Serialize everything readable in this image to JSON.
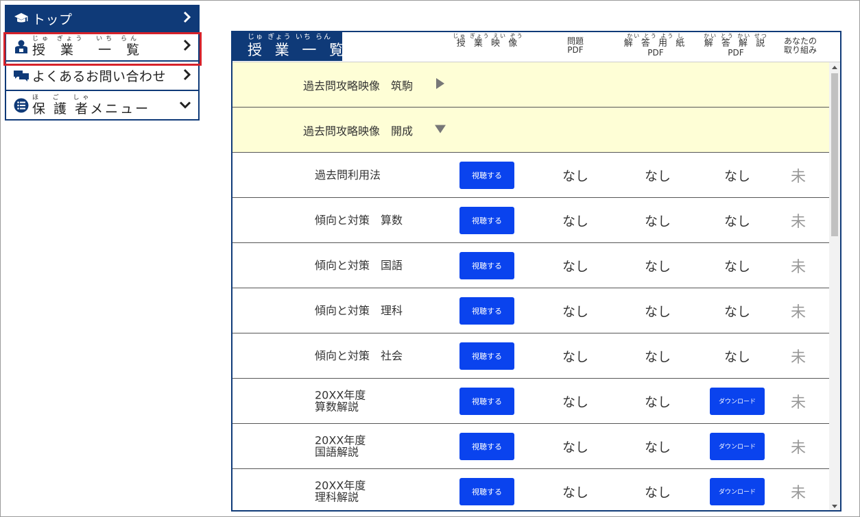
{
  "menu": {
    "top": {
      "label": "トップ"
    },
    "lessons": {
      "ruby": "じゅ ぎょう  いち らん",
      "label": "授 業  一 覧"
    },
    "faq": {
      "label": "よくあるお問い合わせ"
    },
    "guardian": {
      "ruby": "ほ  ご  しゃ",
      "label": "保 護 者メニュー"
    }
  },
  "panel": {
    "title_ruby": "じゅ ぎょう いち らん",
    "title": "授 業 一 覧",
    "columns": {
      "video": {
        "ruby": "じゅ ぎょう えい ぞう",
        "label": "授 業 映 像"
      },
      "problem": {
        "label": "問題",
        "sub": "PDF"
      },
      "answer_sheet": {
        "ruby": "かい とう よう し",
        "label": "解 答 用 紙",
        "sub": "PDF"
      },
      "explanation": {
        "ruby": "かい とう かい せつ",
        "label": "解 答 解 説",
        "sub": "PDF"
      },
      "effort": {
        "label": "あなたの",
        "label2": "取り組み"
      }
    }
  },
  "categories": [
    {
      "label": "過去問攻略映像　筑駒",
      "state": "collapsed"
    },
    {
      "label": "過去問攻略映像　開成",
      "state": "expanded"
    }
  ],
  "rows": [
    {
      "title": "過去問利用法",
      "watch": "視聴する",
      "problem": "なし",
      "answer_sheet": "なし",
      "explanation": "なし",
      "status": "未"
    },
    {
      "title": "傾向と対策　算数",
      "watch": "視聴する",
      "problem": "なし",
      "answer_sheet": "なし",
      "explanation": "なし",
      "status": "未"
    },
    {
      "title": "傾向と対策　国語",
      "watch": "視聴する",
      "problem": "なし",
      "answer_sheet": "なし",
      "explanation": "なし",
      "status": "未"
    },
    {
      "title": "傾向と対策　理科",
      "watch": "視聴する",
      "problem": "なし",
      "answer_sheet": "なし",
      "explanation": "なし",
      "status": "未"
    },
    {
      "title": "傾向と対策　社会",
      "watch": "視聴する",
      "problem": "なし",
      "answer_sheet": "なし",
      "explanation": "なし",
      "status": "未"
    },
    {
      "title": "20XX年度\n算数解説",
      "watch": "視聴する",
      "problem": "なし",
      "answer_sheet": "なし",
      "explanation": "ダウンロード",
      "status": "未"
    },
    {
      "title": "20XX年度\n国語解説",
      "watch": "視聴する",
      "problem": "なし",
      "answer_sheet": "なし",
      "explanation": "ダウンロード",
      "status": "未"
    },
    {
      "title": "20XX年度\n理科解説",
      "watch": "視聴する",
      "problem": "なし",
      "answer_sheet": "なし",
      "explanation": "ダウンロード",
      "status": "未"
    }
  ],
  "colors": {
    "navy": "#0f3a78",
    "button": "#0a43ee",
    "category_bg": "#fefed6",
    "highlight": "#d6222a"
  },
  "icons": [
    "graduation-cap-icon",
    "teacher-book-icon",
    "speech-bubbles-icon",
    "list-circle-icon",
    "chevron-right-icon",
    "chevron-down-icon",
    "triangle-right-icon",
    "triangle-down-icon"
  ]
}
